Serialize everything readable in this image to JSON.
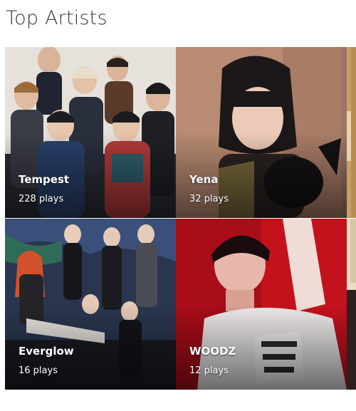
{
  "section": {
    "title": "Top Artists"
  },
  "artists": [
    {
      "name": "Tempest",
      "plays": "228 plays",
      "palette": [
        "#e7e2dc",
        "#c9c3bc",
        "#2e3a4c",
        "#1c1c22"
      ]
    },
    {
      "name": "Yena",
      "plays": "32 plays",
      "palette": [
        "#bd8e74",
        "#9a6c58",
        "#2a2220",
        "#121012"
      ]
    },
    {
      "name": "Everglow",
      "plays": "16 plays",
      "palette": [
        "#2b3a55",
        "#1a2b3d",
        "#4a4e5a",
        "#0e0f14"
      ]
    },
    {
      "name": "WOODZ",
      "plays": "12 plays",
      "palette": [
        "#d4141f",
        "#a30c15",
        "#e8e4e4",
        "#3a0a0d"
      ]
    }
  ]
}
